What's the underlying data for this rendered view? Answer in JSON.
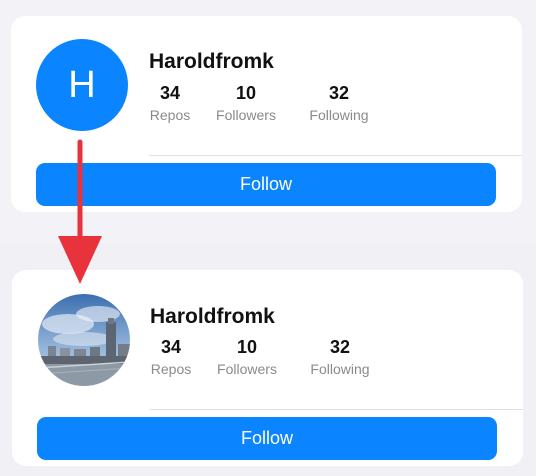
{
  "cards": {
    "before": {
      "avatar_letter": "H",
      "username": "Haroldfromk",
      "stats": [
        {
          "value": "34",
          "label": "Repos"
        },
        {
          "value": "10",
          "label": "Followers"
        },
        {
          "value": "32",
          "label": "Following"
        }
      ],
      "follow_label": "Follow"
    },
    "after": {
      "username": "Haroldfromk",
      "stats": [
        {
          "value": "34",
          "label": "Repos"
        },
        {
          "value": "10",
          "label": "Followers"
        },
        {
          "value": "32",
          "label": "Following"
        }
      ],
      "follow_label": "Follow"
    }
  },
  "colors": {
    "accent": "#0a84ff",
    "arrow": "#e8323c"
  }
}
